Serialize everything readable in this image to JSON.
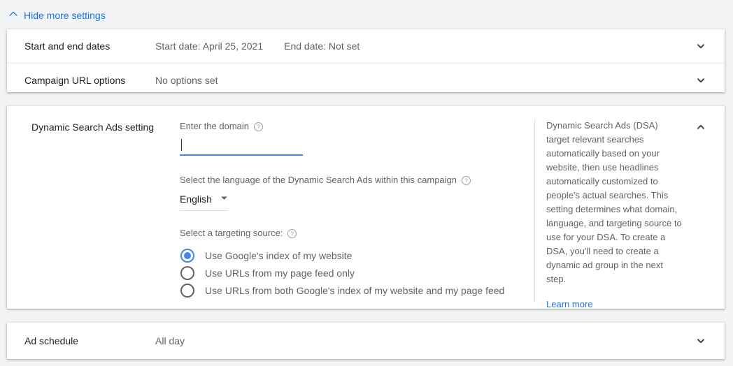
{
  "toggle": {
    "label": "Hide more settings",
    "icon": "chevron-up-icon",
    "color": "#1a73e8"
  },
  "colors": {
    "accent_blue": "#1a73e8",
    "input_focus_blue": "#4285f4",
    "text_primary": "#202124",
    "text_secondary": "#5f6368",
    "page_bg": "#f1f3f4",
    "card_bg": "#ffffff",
    "divider": "#e8eaed"
  },
  "rows": [
    {
      "label": "Start and end dates",
      "values": [
        "Start date: April 25, 2021",
        "End date: Not set"
      ],
      "chevron": "chevron-down-icon"
    },
    {
      "label": "Campaign URL options",
      "values": [
        "No options set"
      ],
      "chevron": "chevron-down-icon"
    }
  ],
  "dsa": {
    "title": "Dynamic Search Ads setting",
    "collapse_icon": "chevron-up-icon",
    "domain": {
      "label": "Enter the domain",
      "help_icon": "help-circle-icon",
      "value": "",
      "placeholder": "",
      "focused": true
    },
    "language": {
      "label": "Select the language of the Dynamic Search Ads within this campaign",
      "help_icon": "help-circle-icon",
      "selected": "English",
      "dropdown_icon": "caret-down-icon"
    },
    "targeting": {
      "label": "Select a targeting source:",
      "help_icon": "help-circle-icon",
      "selected_index": 0,
      "options": [
        "Use Google's index of my website",
        "Use URLs from my page feed only",
        "Use URLs from both Google's index of my website and my page feed"
      ]
    },
    "help": {
      "body": "Dynamic Search Ads (DSA) target relevant searches automatically based on your website, then use headlines automatically customized to people's actual searches. This setting determines what domain, language, and targeting source to use for your DSA. To create a DSA, you'll need to create a dynamic ad group in the next step.",
      "link": "Learn more"
    }
  },
  "schedule": {
    "label": "Ad schedule",
    "value": "All day",
    "chevron": "chevron-down-icon"
  }
}
